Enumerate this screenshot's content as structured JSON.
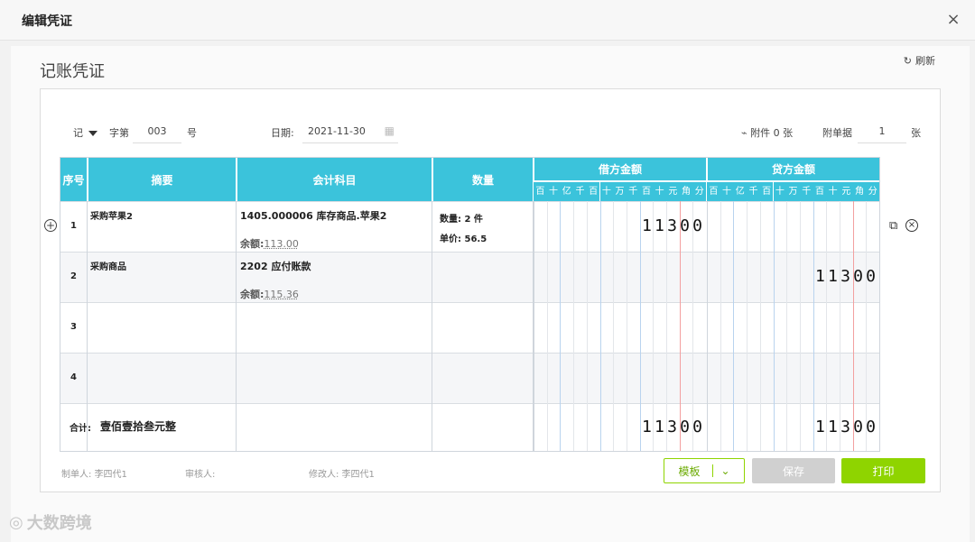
{
  "dialog": {
    "title": "编辑凭证",
    "close_label": "×"
  },
  "panel": {
    "title": "记账凭证",
    "refresh_label": "刷新"
  },
  "form": {
    "voucher_word": "记",
    "word_suffix": "字第",
    "voucher_number": "003",
    "number_suffix": "号",
    "date_label": "日期:",
    "date_value": "2021-11-30",
    "attachment_label": "附件 0 张",
    "bill_label": "附单据",
    "bill_count": "1",
    "bill_unit": "张"
  },
  "table": {
    "headers": {
      "index": "序号",
      "summary": "摘要",
      "account": "会计科目",
      "quantity": "数量",
      "debit": "借方金额",
      "credit": "贷方金额"
    },
    "digit_labels": [
      "百",
      "十",
      "亿",
      "千",
      "百",
      "十",
      "万",
      "千",
      "百",
      "十",
      "元",
      "角",
      "分"
    ],
    "rows": [
      {
        "index": "1",
        "summary": "采购苹果2",
        "account": "1405.000006 库存商品.苹果2",
        "balance_label": "余额:",
        "balance_value": "113.00",
        "qty_line1": "数量: 2 件",
        "qty_line2": "单价: 56.5",
        "debit": "11300",
        "credit": ""
      },
      {
        "index": "2",
        "summary": "采购商品",
        "account": "2202 应付账款",
        "balance_label": "余额:",
        "balance_value": "115.36",
        "qty_line1": "",
        "qty_line2": "",
        "debit": "",
        "credit": "11300"
      },
      {
        "index": "3",
        "summary": "",
        "account": "",
        "balance_label": "",
        "balance_value": "",
        "qty_line1": "",
        "qty_line2": "",
        "debit": "",
        "credit": ""
      },
      {
        "index": "4",
        "summary": "",
        "account": "",
        "balance_label": "",
        "balance_value": "",
        "qty_line1": "",
        "qty_line2": "",
        "debit": "",
        "credit": ""
      }
    ],
    "total": {
      "label": "合计:",
      "text": "壹佰壹拾叁元整",
      "debit": "11300",
      "credit": "11300"
    }
  },
  "footer": {
    "maker": "制单人: 李四代1",
    "reviewer": "审核人:",
    "modifier": "修改人: 李四代1",
    "template_label": "模板",
    "save_label": "保存",
    "print_label": "打印"
  },
  "watermark": "大数跨境",
  "colors": {
    "header_bg": "#3bc3db",
    "primary_green": "#8fd400",
    "template_border": "#8fd400",
    "disabled_gray": "#d0d0d0"
  }
}
